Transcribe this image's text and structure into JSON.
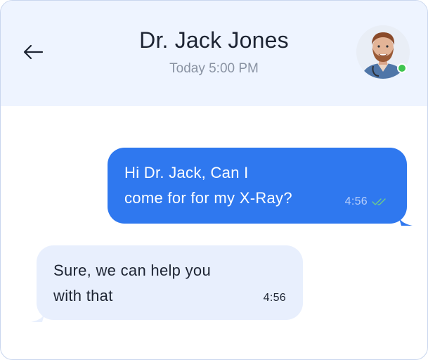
{
  "header": {
    "title": "Dr. Jack Jones",
    "subtitle": "Today 5:00 PM",
    "back_icon": "arrow-left-icon",
    "avatar_status": "online",
    "status_color": "#3fc54f"
  },
  "messages": [
    {
      "direction": "outgoing",
      "text_lines": [
        "Hi Dr. Jack, Can I",
        "come for for my X-Ray?"
      ],
      "time": "4:56",
      "receipt_icon": "double-check-icon",
      "bubble_color": "#2f78ef"
    },
    {
      "direction": "incoming",
      "text_lines": [
        "Sure, we can help you",
        "with that"
      ],
      "time": "4:56",
      "bubble_color": "#e8effd"
    }
  ]
}
